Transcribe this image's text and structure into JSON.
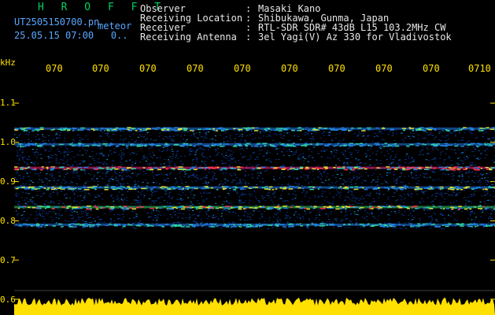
{
  "header": {
    "brand": "H R O F F T",
    "filename": "UT2505150700.pn",
    "filename_suffix": "meteor",
    "datetime": "25.05.15 07:00   0..",
    "fields": [
      {
        "label": "Observer",
        "value": "Masaki Kano"
      },
      {
        "label": "Receiving Location",
        "value": "Shibukawa, Gunma, Japan"
      },
      {
        "label": "Receiver",
        "value": "RTL-SDR SDR# 43dB L15 103.2MHz CW"
      },
      {
        "label": "Receiving Antenna",
        "value": "3el Yagi(V) Az 330 for Vladivostok"
      }
    ]
  },
  "axis": {
    "unit": "kHz",
    "y_ticks": [
      "1.1",
      "1.0",
      "0.9",
      "0.8",
      "0.7",
      "0.6"
    ],
    "x_ticks": [
      "070",
      "070",
      "070",
      "070",
      "070",
      "070",
      "070",
      "070",
      "070",
      "0710"
    ]
  },
  "colors": {
    "label": "#ffe000",
    "text": "#e8e8e8",
    "file": "#58a8ff",
    "brand": "#00d060",
    "bg_noise": "#00206a",
    "strong_line": "#ff2080"
  },
  "spectrogram": {
    "bands_khz": [
      {
        "f": 1.035,
        "strength": 0.55
      },
      {
        "f": 0.995,
        "strength": 0.45
      },
      {
        "f": 0.935,
        "strength": 1.0
      },
      {
        "f": 0.885,
        "strength": 0.7
      },
      {
        "f": 0.835,
        "strength": 0.85
      },
      {
        "f": 0.79,
        "strength": 0.45
      }
    ],
    "noise_range_khz": [
      0.78,
      1.04
    ]
  }
}
